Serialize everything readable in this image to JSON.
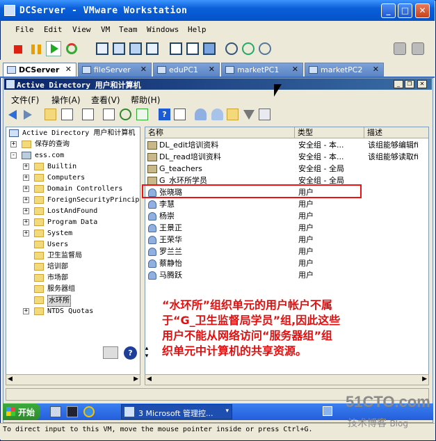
{
  "window": {
    "title": "DCServer - VMware Workstation"
  },
  "menu": [
    "File",
    "Edit",
    "View",
    "VM",
    "Team",
    "Windows",
    "Help"
  ],
  "tabs": [
    {
      "label": "DCServer",
      "active": true
    },
    {
      "label": "fileServer",
      "active": false
    },
    {
      "label": "eduPC1",
      "active": false
    },
    {
      "label": "marketPC1",
      "active": false
    },
    {
      "label": "marketPC2",
      "active": false
    }
  ],
  "mmc": {
    "title": "Active Directory 用户和计算机",
    "menu": [
      "文件(F)",
      "操作(A)",
      "查看(V)",
      "帮助(H)"
    ]
  },
  "tree": {
    "items": [
      {
        "label": "Active Directory 用户和计算机",
        "level": 0
      },
      {
        "label": "保存的查询",
        "level": 1,
        "expander": "+"
      },
      {
        "label": "ess.com",
        "level": 1,
        "expander": "-"
      },
      {
        "label": "Builtin",
        "level": 2,
        "expander": "+"
      },
      {
        "label": "Computers",
        "level": 2,
        "expander": "+"
      },
      {
        "label": "Domain Controllers",
        "level": 2,
        "expander": "+"
      },
      {
        "label": "ForeignSecurityPrincip",
        "level": 2,
        "expander": "+"
      },
      {
        "label": "LostAndFound",
        "level": 2,
        "expander": "+"
      },
      {
        "label": "Program Data",
        "level": 2,
        "expander": "+"
      },
      {
        "label": "System",
        "level": 2,
        "expander": "+"
      },
      {
        "label": "Users",
        "level": 2
      },
      {
        "label": "卫生监督局",
        "level": 2
      },
      {
        "label": "培训部",
        "level": 2
      },
      {
        "label": "市场部",
        "level": 2
      },
      {
        "label": "服务器组",
        "level": 2
      },
      {
        "label": "水环所",
        "level": 2,
        "selected": true
      },
      {
        "label": "NTDS Quotas",
        "level": 2,
        "expander": "+"
      }
    ]
  },
  "list": {
    "headers": [
      "名称",
      "类型",
      "描述"
    ],
    "rows": [
      {
        "name": "DL_edit培训资料",
        "type": "安全组 - 本...",
        "desc": "该组能够编辑fi",
        "icon": "group"
      },
      {
        "name": "DL_read培训资料",
        "type": "安全组 - 本...",
        "desc": "该组能够读取fi",
        "icon": "group"
      },
      {
        "name": "G_teachers",
        "type": "安全组 - 全局",
        "desc": "",
        "icon": "group"
      },
      {
        "name": "G_水环所学员",
        "type": "安全组 - 全局",
        "desc": "",
        "icon": "group"
      },
      {
        "name": "张晓璐",
        "type": "用户",
        "desc": "",
        "icon": "user",
        "highlighted": true
      },
      {
        "name": "李慧",
        "type": "用户",
        "desc": "",
        "icon": "user"
      },
      {
        "name": "杨崇",
        "type": "用户",
        "desc": "",
        "icon": "user"
      },
      {
        "name": "王景正",
        "type": "用户",
        "desc": "",
        "icon": "user"
      },
      {
        "name": "王荣华",
        "type": "用户",
        "desc": "",
        "icon": "user"
      },
      {
        "name": "罗兰兰",
        "type": "用户",
        "desc": "",
        "icon": "user"
      },
      {
        "name": "蔡静怡",
        "type": "用户",
        "desc": "",
        "icon": "user"
      },
      {
        "name": "马腾跃",
        "type": "用户",
        "desc": "",
        "icon": "user"
      }
    ]
  },
  "annotation": {
    "lines": [
      "“水环所”组织单元的用户帐户不属",
      "于“G_卫生监督局学员”组,因此这些",
      "用户不能从网络访问“服务器组”组",
      "织单元中计算机的共享资源。"
    ]
  },
  "taskbar": {
    "start": "开始",
    "task": "3 Microsoft 管理控..."
  },
  "statusbar": {
    "text": "To direct input to this VM, move the mouse pointer inside or press Ctrl+G."
  },
  "watermark": {
    "site": "51CTO.com",
    "sub": "技术博客",
    "blog": "Blog"
  }
}
